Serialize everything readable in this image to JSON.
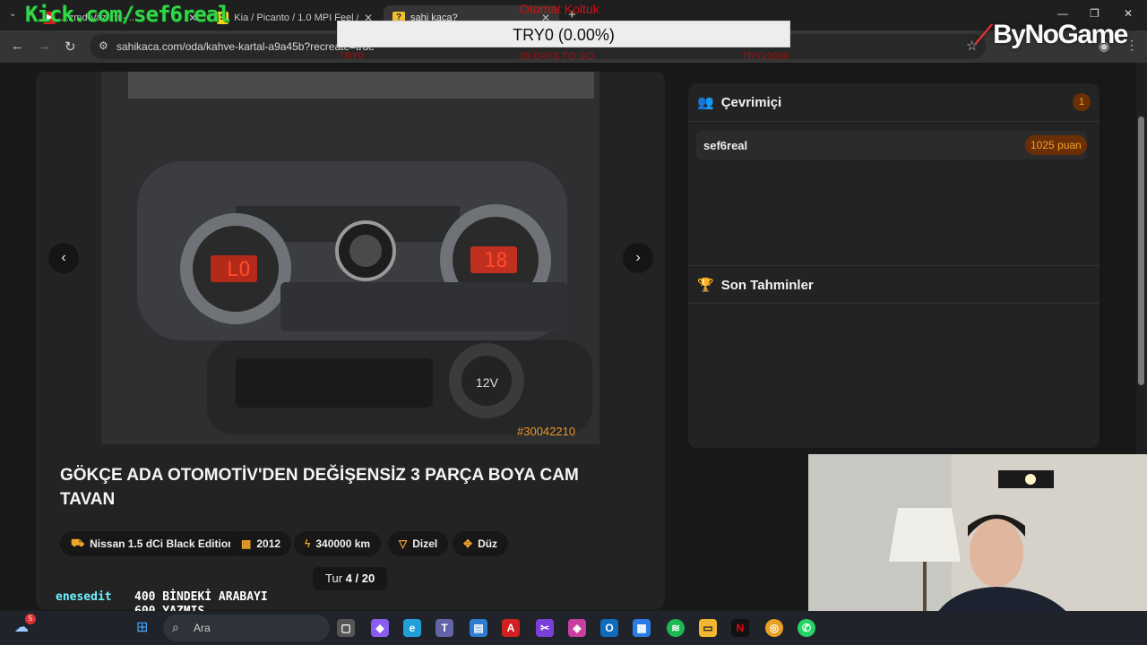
{
  "browser": {
    "tabs": [
      {
        "label": "...zmd Vazam - ...",
        "favicon": "youtube-icon",
        "color": "#e02020"
      },
      {
        "label": "Kia / Picanto / 1.0 MPI Feel / 20",
        "favicon": "s-icon",
        "color": "#f5d31b"
      },
      {
        "label": "sahi kaca?",
        "favicon": "question-icon",
        "color": "#f0a32a"
      }
    ],
    "url": "sahikaca.com/oda/kahve-kartal-a9a45b?recreate=true"
  },
  "overlay": {
    "kick": "Kick.com/sef6real",
    "goal_title": "Otomat Koltuk",
    "goal_value": "TRY0 (0.00%)",
    "goal_left": "TRY0",
    "goal_mid": "39 DAYS TO GO",
    "goal_right": "TRY10000",
    "brand": "ByNoGame"
  },
  "listing": {
    "photo_id": "#30042210",
    "title": "GÖKÇE ADA OTOMOTİV'DEN DEĞİŞENSİZ 3 PARÇA BOYA CAM TAVAN",
    "chips": [
      {
        "icon": "car-icon",
        "label": "Nissan 1.5 dCi Black Edition"
      },
      {
        "icon": "calendar-icon",
        "label": "2012"
      },
      {
        "icon": "gauge-icon",
        "label": "340000 km"
      },
      {
        "icon": "fuel-icon",
        "label": "Dizel"
      },
      {
        "icon": "gear-icon",
        "label": "Düz"
      }
    ],
    "round_label": "Tur",
    "round_value": "4 / 20"
  },
  "online": {
    "title": "Çevrimiçi",
    "count": "1",
    "players": [
      {
        "name": "sef6real",
        "score": "1025 puan"
      }
    ]
  },
  "guesses": {
    "title": "Son Tahminler"
  },
  "chat": [
    {
      "user": "enesedit",
      "message": "400 BİNDEKİ ARABAYI"
    },
    {
      "user": "",
      "message": "600 YAZMIŞ"
    }
  ],
  "taskbar": {
    "search_placeholder": "Ara",
    "notification_count": "5"
  },
  "colors": {
    "accent": "#f0a32a",
    "kick_green": "#34d64a"
  }
}
